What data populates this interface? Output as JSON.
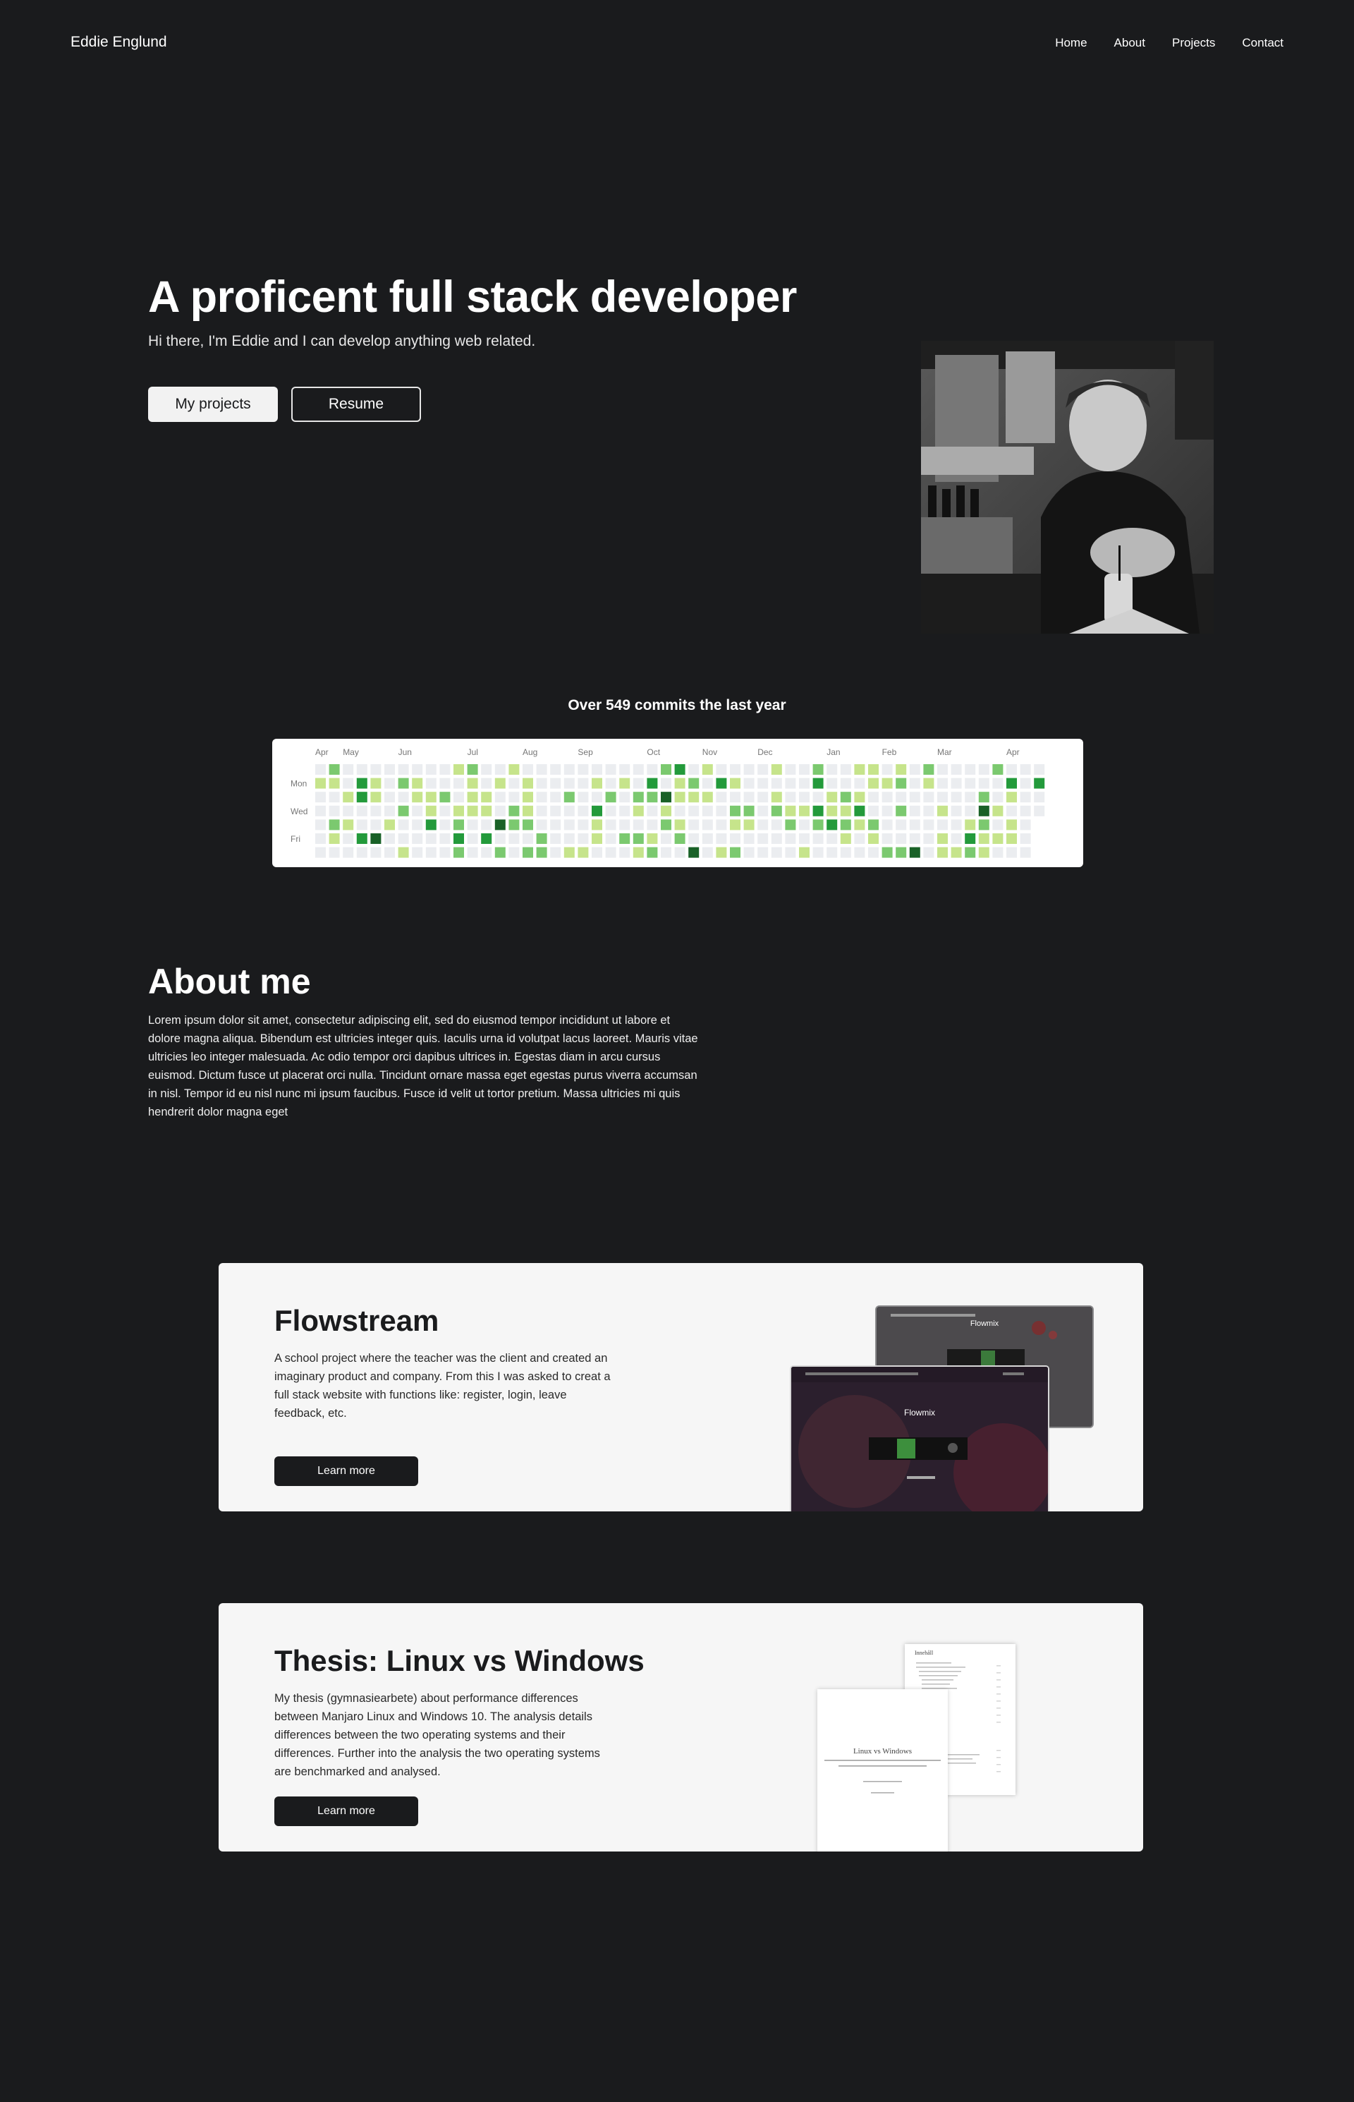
{
  "nav": {
    "brand": "Eddie Englund",
    "links": [
      "Home",
      "About",
      "Projects",
      "Contact"
    ]
  },
  "hero": {
    "title": "A proficent full stack developer",
    "subtitle": "Hi there, I'm Eddie and I can develop anything web related.",
    "primary_button": "My projects",
    "secondary_button": "Resume"
  },
  "commits": {
    "title": "Over 549 commits the last year",
    "months": [
      "Apr",
      "May",
      "Jun",
      "Jul",
      "Aug",
      "Sep",
      "Oct",
      "Nov",
      "Dec",
      "Jan",
      "Feb",
      "Mar",
      "Apr"
    ],
    "weekdays": [
      "Mon",
      "Wed",
      "Fri"
    ],
    "colors": [
      "#ebedf0",
      "#c6e48b",
      "#7bc96f",
      "#239a3b",
      "#196127"
    ]
  },
  "about": {
    "title": "About me",
    "text": " Lorem ipsum dolor sit amet, consectetur adipiscing elit, sed do eiusmod tempor incididunt ut labore et dolore magna aliqua. Bibendum est ultricies integer quis. Iaculis urna id volutpat lacus laoreet. Mauris vitae ultricies leo integer malesuada. Ac odio tempor orci dapibus ultrices in. Egestas diam in arcu cursus euismod. Dictum fusce ut placerat orci nulla. Tincidunt ornare massa eget egestas purus viverra accumsan in nisl. Tempor id eu nisl nunc mi ipsum faucibus. Fusce id velit ut tortor pretium. Massa ultricies mi quis hendrerit dolor magna eget"
  },
  "projects": [
    {
      "title": "Flowstream",
      "description": "A school project where the teacher was the client and created an imaginary product and company. From this I was asked to creat a full stack website with functions like: register, login, leave feedback, etc.",
      "button": "Learn more",
      "mock_front_title": "Flowmix",
      "mock_back_title": "Flowmix"
    },
    {
      "title": "Thesis: Linux vs Windows",
      "description": "My thesis (gymnasiearbete) about performance differences between Manjaro Linux and Windows 10. The analysis details differences between the two operating systems and their differences. Further into the analysis the two operating systems are benchmarked and analysed.",
      "button": "Learn more",
      "doc_front_title": "Linux vs Windows",
      "doc_back_title": "Innehåll"
    }
  ]
}
